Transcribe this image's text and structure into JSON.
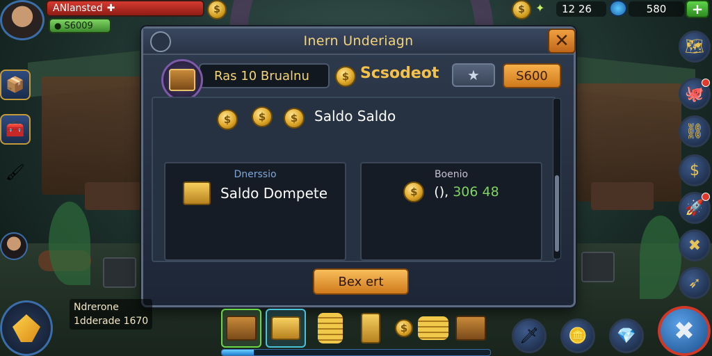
{
  "hud": {
    "player_name": "ANlansted",
    "player_money": "S6009",
    "resource_count": "12 26",
    "gem_count": "580"
  },
  "dialog": {
    "title": "Inern Underiagn",
    "close_icon": "close-x-icon",
    "offer_name": "Ras 10 Brualnu",
    "offer_label": "Scsodeot",
    "price": "S600",
    "saldo_text": "Saldo Saldo",
    "left_panel": {
      "label": "Dnerssio",
      "main": "Saldo Dompete"
    },
    "right_panel": {
      "label": "Boenio",
      "amount_prefix": "(),",
      "amount_value": "306 48"
    },
    "exit_button": "Bex ert"
  },
  "player_card": {
    "line1": "Ndrerone",
    "line2": "1dderade 1670"
  },
  "inventory": {
    "progress_fraction": 0.12,
    "slots": [
      "chest",
      "gold-box",
      "coin-stack",
      "gold-bar",
      "coins",
      "coin-pile",
      "chest"
    ]
  },
  "colors": {
    "accent_gold": "#f4c24a",
    "close_orange": "#e0801e",
    "panel_dark": "#161c26",
    "hud_red": "#d63a2f",
    "hud_green": "#5fd34a"
  }
}
